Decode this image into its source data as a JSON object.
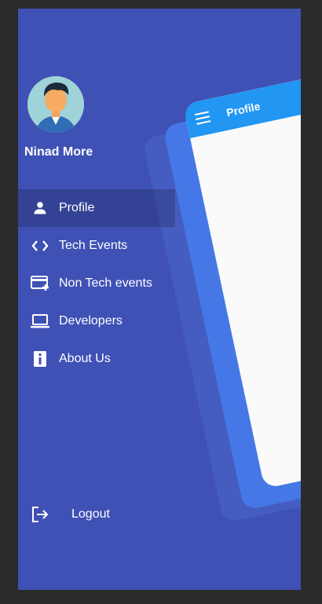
{
  "user": {
    "name": "Ninad More"
  },
  "menu": {
    "items": [
      {
        "label": "Profile",
        "icon": "person-icon",
        "active": true
      },
      {
        "label": "Tech Events",
        "icon": "code-icon",
        "active": false
      },
      {
        "label": "Non Tech events",
        "icon": "card-add-icon",
        "active": false
      },
      {
        "label": "Developers",
        "icon": "laptop-icon",
        "active": false
      },
      {
        "label": "About Us",
        "icon": "info-icon",
        "active": false
      }
    ],
    "logout_label": "Logout"
  },
  "preview": {
    "title": "Profile"
  },
  "colors": {
    "drawer_bg": "#3f51b5",
    "appbar": "#2196f3",
    "active_item_bg": "rgba(0,0,0,0.18)"
  }
}
